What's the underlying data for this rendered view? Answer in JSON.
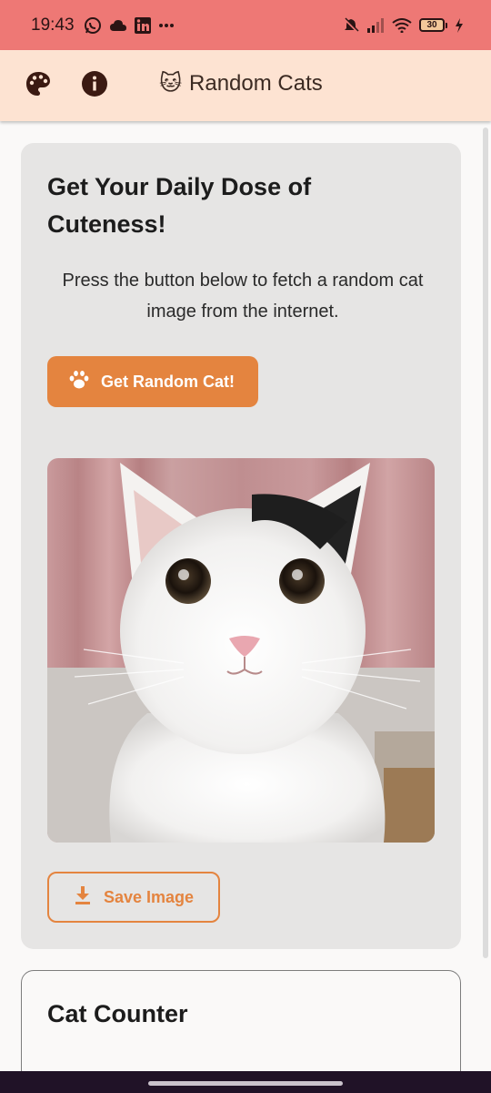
{
  "status_bar": {
    "time": "19:43",
    "left_icons": [
      "whatsapp-icon",
      "cloud-icon",
      "linkedin-icon",
      "more-dots-icon"
    ],
    "right_icons": [
      "mute-icon",
      "signal-icon",
      "wifi-icon",
      "battery-icon",
      "charging-icon"
    ],
    "battery_level": "30",
    "background_color": "#ee7875"
  },
  "app_bar": {
    "title": "Random Cats",
    "title_emoji": "🐱",
    "icons": [
      "palette-icon",
      "info-icon"
    ],
    "background_color": "#fde3d2"
  },
  "main_card": {
    "title": "Get Your Daily Dose of Cuteness!",
    "description": "Press the button below to fetch a random cat image from the internet.",
    "random_button": {
      "label": "Get Random Cat!",
      "icon": "paw-icon"
    },
    "image_alt": "cat-photo",
    "save_button": {
      "label": "Save Image",
      "icon": "download-icon"
    }
  },
  "counter_card": {
    "title": "Cat Counter"
  },
  "colors": {
    "accent": "#e4843f",
    "card_background": "#e6e5e4",
    "page_background": "#faf9f8"
  }
}
